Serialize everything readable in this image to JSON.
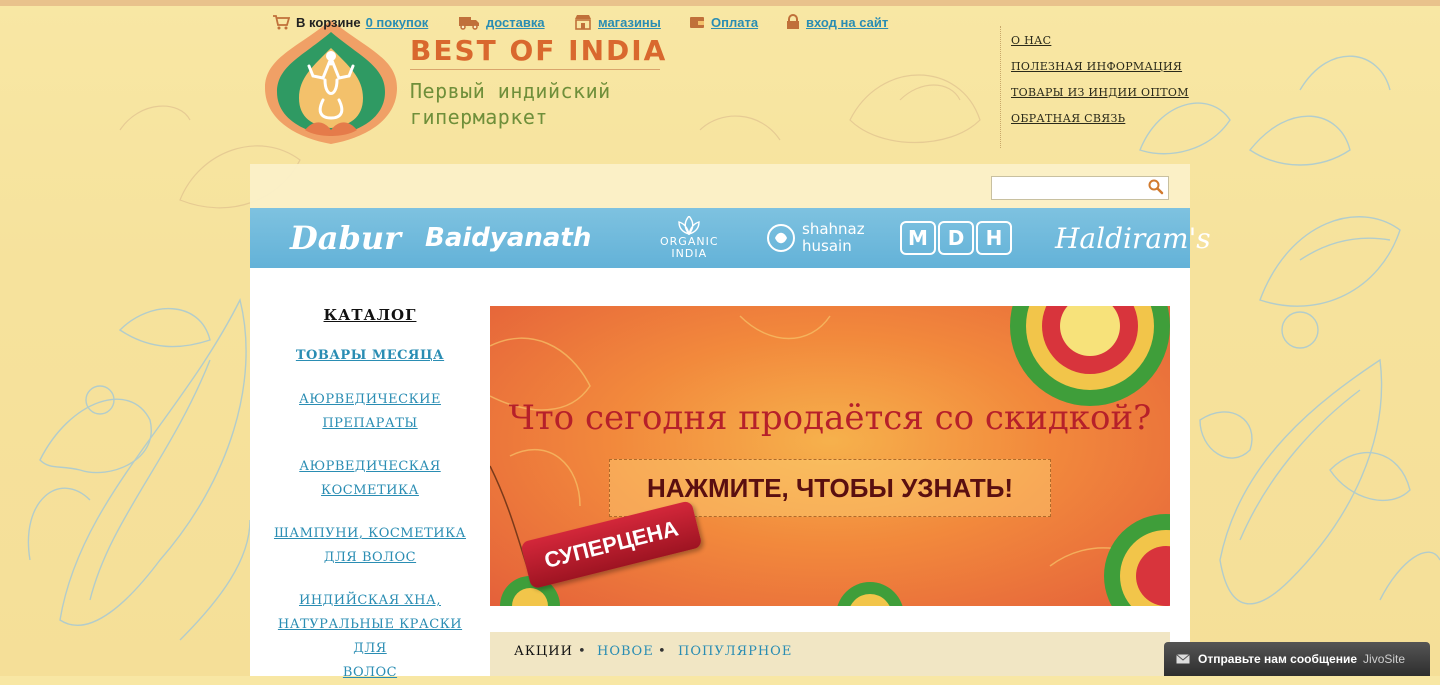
{
  "header": {
    "brand": "BEST OF INDIA",
    "tagline": "Первый индийский гипермаркет"
  },
  "top_links": [
    "О НАС",
    "ПОЛЕЗНАЯ ИНФОРМАЦИЯ",
    "ТОВАРЫ ИЗ ИНДИИ ОПТОМ",
    "ОБРАТНАЯ СВЯЗЬ"
  ],
  "toolbar": {
    "cart_label": "В корзине",
    "cart_count": "0 покупок",
    "delivery": "доставка",
    "stores": "магазины",
    "payment": "Оплата",
    "login": "вход на сайт",
    "search_placeholder": ""
  },
  "brands": {
    "dabur": "Dabur",
    "baidyanath": "Baidyanath",
    "organic_1": "ORGANIC",
    "organic_2": "INDIA",
    "shahnaz_1": "shahnaz",
    "shahnaz_2": "husain",
    "mdh": [
      "M",
      "D",
      "H"
    ],
    "haldirams": "Haldiram's"
  },
  "catalog": {
    "title": "КАТАЛОГ",
    "items": [
      [
        "ТОВАРЫ МЕСЯЦА"
      ],
      [
        "АЮРВЕДИЧЕСКИЕ",
        "ПРЕПАРАТЫ"
      ],
      [
        "АЮРВЕДИЧЕСКАЯ",
        "КОСМЕТИКА"
      ],
      [
        "ШАМПУНИ, КОСМЕТИКА",
        "ДЛЯ ВОЛОС"
      ],
      [
        "ИНДИЙСКАЯ ХНА,",
        "НАТУРАЛЬНЫЕ КРАСКИ ДЛЯ",
        "ВОЛОС"
      ]
    ]
  },
  "banner": {
    "headline": "Что сегодня продаётся со скидкой?",
    "button": "НАЖМИТЕ, ЧТОБЫ УЗНАТЬ!",
    "tag": "СУПЕРЦЕНА"
  },
  "tabs": [
    "АКЦИИ",
    "НОВОЕ",
    "ПОПУЛЯРНОЕ"
  ],
  "chat": {
    "label": "Отправьте нам сообщение",
    "brand": "JivoSite"
  },
  "colors": {
    "background": "#f6e29c",
    "accent_orange": "#d9682e",
    "tagline_green": "#6f8f3a",
    "link_blue": "#2a8db3",
    "brand_strip": "#6fb9dc",
    "banner_red": "#b6202a"
  }
}
